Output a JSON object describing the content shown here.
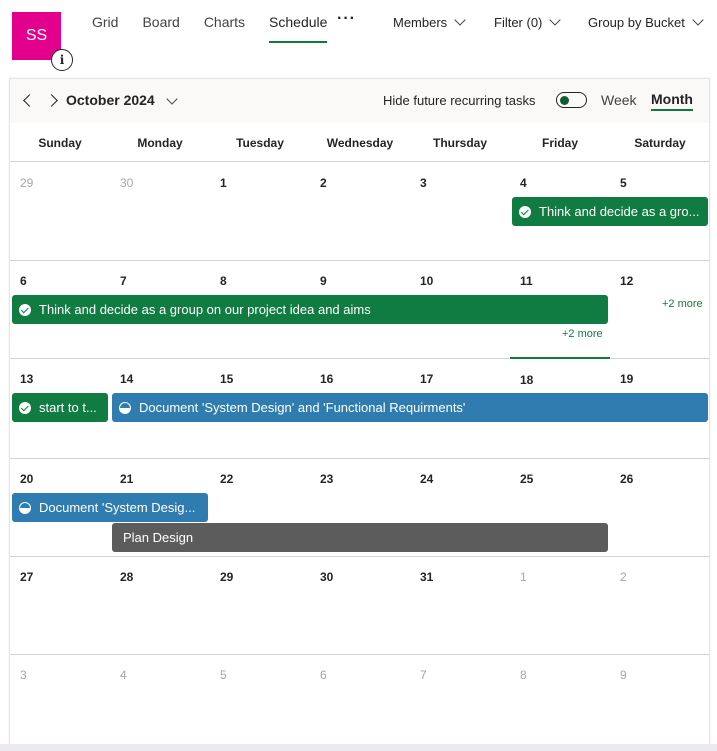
{
  "header": {
    "avatar_initials": "SS",
    "info_icon_glyph": "i",
    "nav_tabs": [
      {
        "label": "Grid"
      },
      {
        "label": "Board"
      },
      {
        "label": "Charts"
      },
      {
        "label": "Schedule",
        "active": true
      }
    ],
    "more_glyph": "···",
    "members_label": "Members",
    "filter_label": "Filter (0)",
    "group_label": "Group by Bucket"
  },
  "calendar": {
    "month_title": "October 2024",
    "hide_recurring_label": "Hide future recurring tasks",
    "hide_recurring_on": true,
    "view_week": "Week",
    "view_month": "Month",
    "active_view": "Month",
    "weekdays": [
      "Sunday",
      "Monday",
      "Tuesday",
      "Wednesday",
      "Thursday",
      "Friday",
      "Saturday"
    ],
    "weeks": [
      [
        "29",
        "30",
        "1",
        "2",
        "3",
        "4",
        "5"
      ],
      [
        "6",
        "7",
        "8",
        "9",
        "10",
        "11",
        "12"
      ],
      [
        "13",
        "14",
        "15",
        "16",
        "17",
        "18",
        "19"
      ],
      [
        "20",
        "21",
        "22",
        "23",
        "24",
        "25",
        "26"
      ],
      [
        "27",
        "28",
        "29",
        "30",
        "31",
        "1",
        "2"
      ],
      [
        "3",
        "4",
        "5",
        "6",
        "7",
        "8",
        "9"
      ]
    ],
    "today": "18",
    "events": {
      "w1_think": "Think and decide as a gro...",
      "w2_think": "Think and decide as a group on our project idea and aims",
      "w3_start": "start to t...",
      "w3_document": "Document 'System Design' and 'Functional Requirments'",
      "w4_document": "Document 'System Desig...",
      "w4_plan": "Plan Design"
    },
    "more_friday": "+2 more",
    "more_saturday": "+2 more"
  },
  "colors": {
    "avatar": "#e3008c",
    "accent_green": "#107c41",
    "task_blue": "#2f7db0",
    "task_gray": "#5c5c5c"
  },
  "icons": {
    "completed_task": "check-circle-icon",
    "in_progress_task": "half-circle-icon"
  }
}
